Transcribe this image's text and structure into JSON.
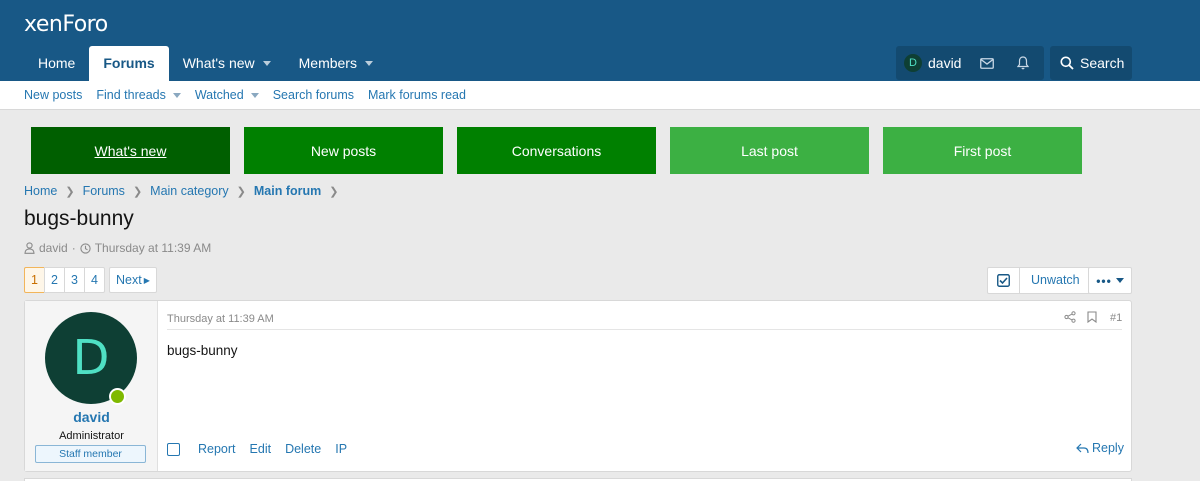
{
  "header": {
    "logo": "xenForo",
    "nav": [
      "Home",
      "Forums",
      "What's new",
      "Members"
    ],
    "user": {
      "initial": "D",
      "name": "david"
    },
    "search_label": "Search"
  },
  "subnav": [
    "New posts",
    "Find threads",
    "Watched",
    "Search forums",
    "Mark forums read"
  ],
  "buttons": [
    {
      "label": "What's new",
      "color": "#005f00"
    },
    {
      "label": "New posts",
      "color": "#008000"
    },
    {
      "label": "Conversations",
      "color": "#008000"
    },
    {
      "label": "Last post",
      "color": "#3cb043"
    },
    {
      "label": "First post",
      "color": "#3cb043"
    }
  ],
  "breadcrumb": [
    "Home",
    "Forums",
    "Main category",
    "Main forum"
  ],
  "thread": {
    "title": "bugs-bunny",
    "author": "david",
    "date": "Thursday at 11:39 AM"
  },
  "pager": {
    "pages": [
      "1",
      "2",
      "3",
      "4"
    ],
    "next": "Next"
  },
  "watch_label": "Unwatch",
  "post": {
    "avatar_initial": "D",
    "username": "david",
    "user_title": "Administrator",
    "banner": "Staff member",
    "date": "Thursday at 11:39 AM",
    "number": "#1",
    "body": "bugs-bunny",
    "actions": [
      "Report",
      "Edit",
      "Delete",
      "IP"
    ],
    "reply": "Reply"
  }
}
